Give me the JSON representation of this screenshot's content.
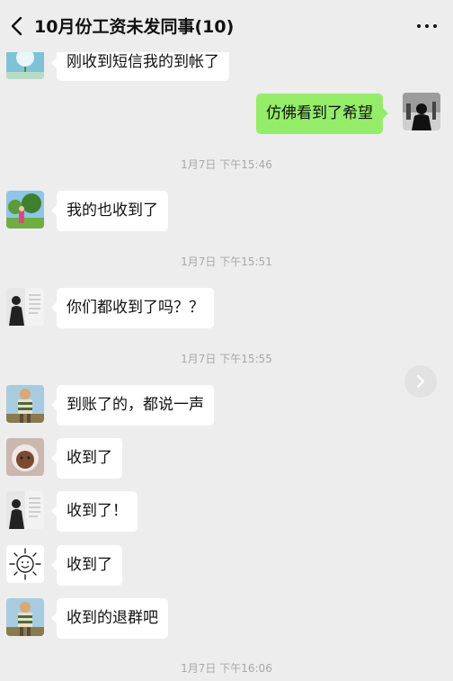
{
  "header": {
    "title": "10月份工资未发同事(10)",
    "back_icon": "chevron-left-icon",
    "more_icon": "more-dots-icon"
  },
  "messages": [
    {
      "side": "left",
      "avatar": "dandelion-avatar",
      "text": "刚收到短信我的到帐了"
    },
    {
      "side": "right",
      "avatar": "silhouette-avatar",
      "text": "仿佛看到了希望"
    },
    {
      "time": "1月7日 下午15:46"
    },
    {
      "side": "left",
      "avatar": "garden-avatar",
      "text": "我的也收到了"
    },
    {
      "time": "1月7日 下午15:51"
    },
    {
      "side": "left",
      "avatar": "book-avatar",
      "text": "你们都收到了吗？？"
    },
    {
      "time": "1月7日 下午15:55"
    },
    {
      "side": "left",
      "avatar": "striped-shirt-avatar",
      "text": "到账了的，都说一声"
    },
    {
      "side": "left",
      "avatar": "cat-avatar",
      "text": "收到了"
    },
    {
      "side": "left",
      "avatar": "book-avatar",
      "text": "收到了！"
    },
    {
      "side": "left",
      "avatar": "sun-avatar",
      "text": "收到了"
    },
    {
      "side": "left",
      "avatar": "striped-shirt-avatar",
      "text": "收到的退群吧"
    },
    {
      "time": "1月7日 下午16:06"
    }
  ],
  "colors": {
    "background": "#ededed",
    "bubble_left": "#ffffff",
    "bubble_right": "#95ec69",
    "timestamp": "#a8a8a8"
  }
}
